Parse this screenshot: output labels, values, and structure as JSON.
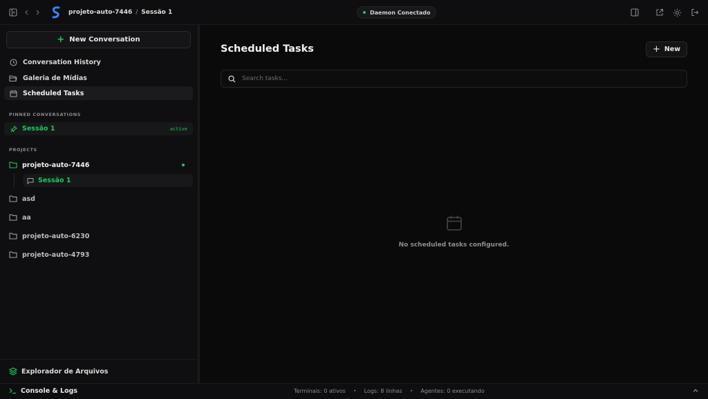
{
  "header": {
    "breadcrumb": [
      "projeto-auto-7446",
      "Sessão 1"
    ],
    "breadcrumb_separator": "/",
    "status": "Daemon Conectado",
    "status_color": "#22c55e"
  },
  "sidebar": {
    "new_conversation_label": "New Conversation",
    "nav": [
      {
        "label": "Conversation History",
        "icon": "clock-icon"
      },
      {
        "label": "Galeria de Mídias",
        "icon": "folder-open-icon"
      },
      {
        "label": "Scheduled Tasks",
        "icon": "calendar-icon",
        "active": true
      }
    ],
    "pinned_title": "PINNED CONVERSATIONS",
    "pinned": {
      "label": "Sessão 1",
      "tag": "active"
    },
    "projects_title": "PROJECTS",
    "projects": [
      {
        "label": "projeto-auto-7446",
        "open": true,
        "children": [
          "Sessão 1"
        ]
      },
      {
        "label": "asd"
      },
      {
        "label": "aa"
      },
      {
        "label": "projeto-auto-6230"
      },
      {
        "label": "projeto-auto-4793"
      }
    ],
    "files_label": "Explorador de Arquivos"
  },
  "main": {
    "title": "Scheduled Tasks",
    "new_button_label": "New",
    "search_placeholder": "Search tasks...",
    "empty_message": "No scheduled tasks configured."
  },
  "footer": {
    "console_label": "Console & Logs",
    "stats": [
      "Terminais: 0 ativos",
      "Logs: 8 linhas",
      "Agentes: 0 executando"
    ],
    "separator": "•"
  },
  "accent_color": "#22c55e"
}
